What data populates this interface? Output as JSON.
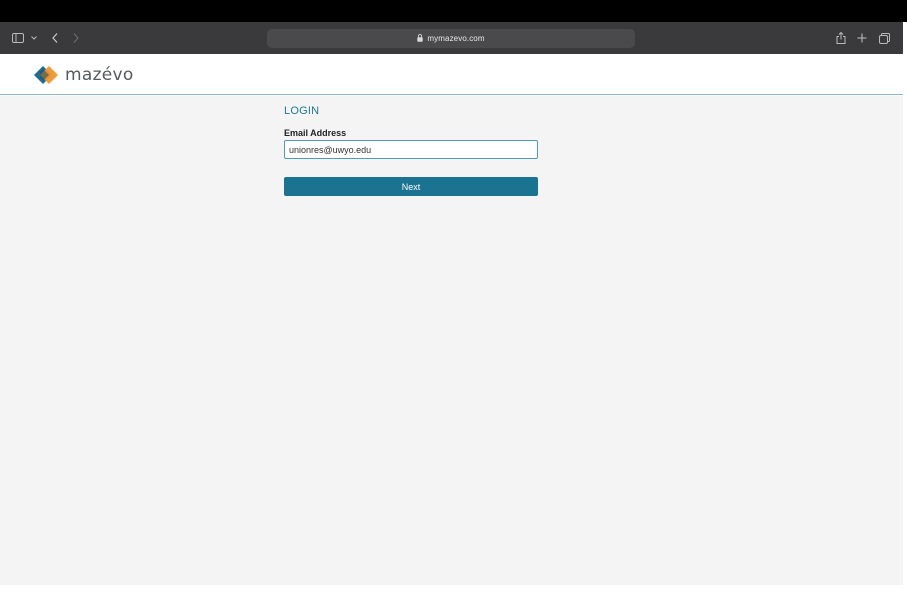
{
  "browser": {
    "url": "mymazevo.com",
    "icons": {
      "sidebar": "sidebar-icon",
      "chevron": "chevron-down-icon",
      "back": "back-arrow-icon",
      "forward": "forward-arrow-icon",
      "reader": "reader-icon",
      "lock": "lock-icon",
      "reload": "reload-icon",
      "share": "share-icon",
      "new_tab": "plus-icon",
      "tabs": "tabs-overview-icon"
    }
  },
  "site": {
    "logo_text": "mazévo",
    "colors": {
      "accent": "#1a7491",
      "logo_orange": "#f0962e",
      "logo_blue": "#1e6f96"
    }
  },
  "login": {
    "title": "LOGIN",
    "email_label": "Email Address",
    "email_value": "unionres@uwyo.edu",
    "next_label": "Next"
  }
}
